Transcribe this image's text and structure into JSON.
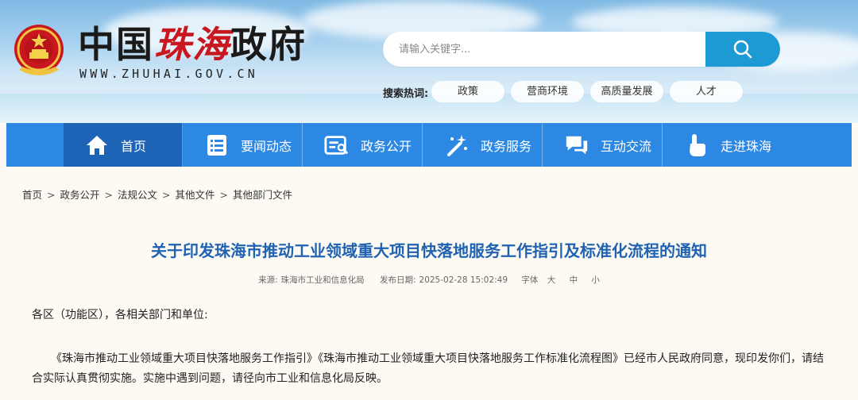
{
  "header": {
    "site_title_prefix": "中国",
    "site_title_city": "珠海",
    "site_title_suffix": "政府",
    "site_url": "WWW.ZHUHAI.GOV.CN",
    "search_placeholder": "请输入关键字...",
    "hot_label": "搜索热词:",
    "hot_tags": [
      "政策",
      "营商环境",
      "高质量发展",
      "人才"
    ]
  },
  "nav": {
    "items": [
      {
        "label": "首页",
        "icon": "home-icon"
      },
      {
        "label": "要闻动态",
        "icon": "news-list-icon"
      },
      {
        "label": "政务公开",
        "icon": "document-search-icon"
      },
      {
        "label": "政务服务",
        "icon": "magic-wand-icon"
      },
      {
        "label": "互动交流",
        "icon": "chat-bubble-icon"
      },
      {
        "label": "走进珠海",
        "icon": "hand-pointer-icon"
      }
    ],
    "active_index": 0
  },
  "breadcrumb": [
    "首页",
    "政务公开",
    "法规公文",
    "其他文件",
    "其他部门文件"
  ],
  "article": {
    "title": "关于印发珠海市推动工业领域重大项目快落地服务工作指引及标准化流程的通知",
    "meta_source_label": "来源:",
    "meta_source": "珠海市工业和信息化局",
    "meta_date_label": "发布日期:",
    "meta_date": "2025-02-28 15:02:49",
    "meta_font_label": "字体",
    "meta_font_sizes": [
      "大",
      "中",
      "小"
    ],
    "salutation": "各区（功能区），各相关部门和单位:",
    "body": "《珠海市推动工业领域重大项目快落地服务工作指引》《珠海市推动工业领域重大项目快落地服务工作标准化流程图》已经市人民政府同意，现印发你们，请结合实际认真贯彻实施。实施中遇到问题，请径向市工业和信息化局反映。"
  },
  "colors": {
    "nav_bg": "#2c88e2",
    "nav_active": "#1d63b6",
    "title_blue": "#1f62b2",
    "search_button": "#1d9ad3",
    "logo_red": "#c8171e"
  }
}
